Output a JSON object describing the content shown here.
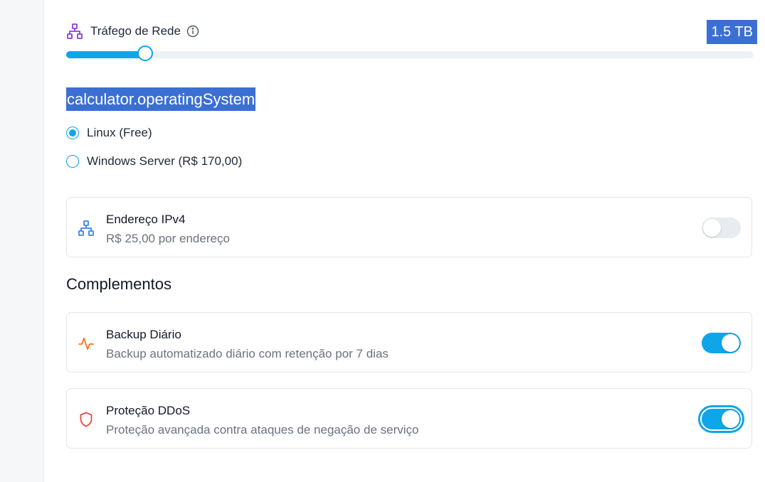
{
  "traffic": {
    "label": "Tráfego de Rede",
    "value": "1.5 TB",
    "slider_fraction": 0.115,
    "icon": "network-icon",
    "info_icon": "info-icon"
  },
  "os": {
    "heading": "calculator.operatingSystem",
    "options": [
      {
        "label": "Linux (Free)",
        "selected": true
      },
      {
        "label": "Windows Server (R$ 170,00)",
        "selected": false
      }
    ]
  },
  "ipv4": {
    "title": "Endereço IPv4",
    "description": "R$ 25,00 por endereço",
    "enabled": false,
    "icon": "network-icon"
  },
  "addons": {
    "title": "Complementos",
    "items": [
      {
        "title": "Backup Diário",
        "description": "Backup automatizado diário com retenção por 7 dias",
        "enabled": true,
        "icon": "activity-icon"
      },
      {
        "title": "Proteção DDoS",
        "description": "Proteção avançada contra ataques de negação de serviço",
        "enabled": true,
        "icon": "shield-icon"
      }
    ]
  },
  "colors": {
    "accent": "#0ea5e9",
    "selection_highlight": "#3b6fd4",
    "network_icon_purple": "#8b3fd9",
    "network_icon_blue": "#3b82f6",
    "activity_icon": "#f97316",
    "shield_icon": "#ef4444"
  }
}
